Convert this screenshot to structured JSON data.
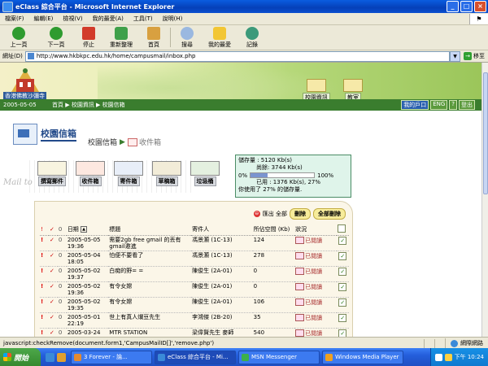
{
  "window": {
    "title": "eClass 綜合平台 - Microsoft Internet Explorer",
    "controls": [
      "_",
      "□",
      "×"
    ]
  },
  "menu": [
    "檔案(F)",
    "編輯(E)",
    "檢視(V)",
    "我的最愛(A)",
    "工具(T)",
    "說明(H)"
  ],
  "toolbar": {
    "back": "上一頁",
    "forward": "下一頁",
    "stop": "停止",
    "refresh": "重新整理",
    "home": "首頁",
    "search": "搜尋",
    "favorites": "我的最愛",
    "history": "記錄"
  },
  "address": {
    "label": "網址(D)",
    "url": "http://www.hkbkpc.edu.hk/home/campusmail/inbox.php",
    "go": "移至"
  },
  "banner": {
    "school_name": "香港佛教沙彌寺",
    "campus_info": "校園資訊",
    "classroom": "教室"
  },
  "nav": {
    "date": "2005-05-05",
    "breadcrumb": "首頁 ▶ 校園資訊 ▶ 校園信箱",
    "my_account": "我的戶口",
    "lang": "ENG",
    "help": "?",
    "logout": "登出"
  },
  "section": {
    "title": "校園信箱",
    "crumb_main": "校園信箱",
    "crumb_sub": "收件箱",
    "watermark": "Mail to"
  },
  "mail_buttons": [
    "撰寫郵件",
    "收件箱",
    "寄件箱",
    "草稿箱",
    "垃圾桶"
  ],
  "quota": {
    "total": "儲存量 : 5120 Kb(s)",
    "remaining": "尚餘: 3744 Kb(s)",
    "min": "0%",
    "max": "100%",
    "used_percent": 27,
    "used": "已用 : 1376 Kb(s), 27%",
    "summary": "你使用了 27% 的儲存量."
  },
  "actions": {
    "export": "匯出 全部",
    "delete": "刪除",
    "delete_all": "全部刪除"
  },
  "table": {
    "headers": {
      "date": "日期",
      "title": "標題",
      "sender": "寄件人",
      "size": "所佔空間 (Kb)",
      "status": "狀況"
    },
    "rows": [
      {
        "imp": "!",
        "chk": "✓",
        "att": "0",
        "date": "2005-05-05 19:36",
        "title": "需要2gb free gmail 的丟有 gmail邀進",
        "sender": "馮景灝 (1C-13)",
        "size": "124",
        "status": "已閱讀"
      },
      {
        "imp": "!",
        "chk": "✓",
        "att": "0",
        "date": "2005-05-04 18:05",
        "title": "怕便不要看了",
        "sender": "馮景灝 (1C-13)",
        "size": "278",
        "status": "已閱讀"
      },
      {
        "imp": "!",
        "chk": "✓",
        "att": "0",
        "date": "2005-05-02 19:37",
        "title": "白痴的野= =",
        "sender": "陳俊生 (2A-01)",
        "size": "0",
        "status": "已閱讀"
      },
      {
        "imp": "!",
        "chk": "✓",
        "att": "0",
        "date": "2005-05-02 19:36",
        "title": "有令女嫦",
        "sender": "陳俊生 (2A-01)",
        "size": "0",
        "status": "已閱讀"
      },
      {
        "imp": "!",
        "chk": "✓",
        "att": "0",
        "date": "2005-05-02 19:35",
        "title": "有令女嫦",
        "sender": "陳俊生 (2A-01)",
        "size": "106",
        "status": "已閱讀"
      },
      {
        "imp": "!",
        "chk": "✓",
        "att": "0",
        "date": "2005-05-01 22:19",
        "title": "世上有真人爛豆先生",
        "sender": "李鴻傑 (2B-20)",
        "size": "35",
        "status": "已閱讀"
      },
      {
        "imp": "!",
        "chk": "✓",
        "att": "0",
        "date": "2005-03-24",
        "title": "MTR STATION",
        "sender": "梁偉賢先生 麥師",
        "size": "540",
        "status": "已閱讀"
      }
    ]
  },
  "status": {
    "text": "javascript:checkRemove(document.form1,'CampusMailID[]','remove.php')",
    "zone": "網際網路"
  },
  "taskbar": {
    "start": "開始",
    "tasks": [
      "3 Forever - 論...",
      "eClass 綜合平台 - Mi...",
      "MSN Messenger",
      "Windows Media Player"
    ],
    "clock": "下午 10:24"
  }
}
